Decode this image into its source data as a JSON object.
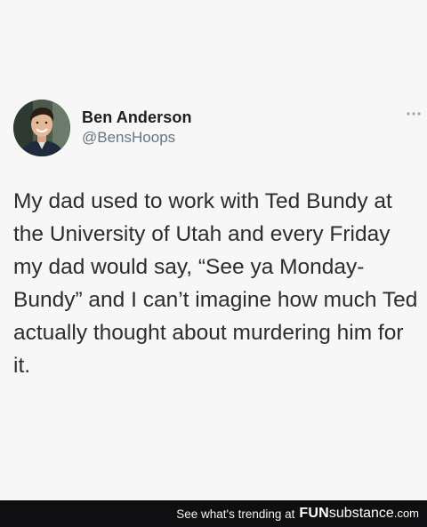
{
  "tweet": {
    "author_name": "Ben Anderson",
    "author_handle": "@BensHoops",
    "text": "My dad used to work with Ted Bundy at the University of Utah and every Friday my dad would say, “See ya Monday-Bundy” and I can’t imagine how much Ted actually thought about murdering him for it."
  },
  "footer": {
    "text": "See what's trending at",
    "brand_fun": "FUN",
    "brand_sub": "substance",
    "brand_tld": ".com"
  },
  "icons": {
    "more": "more-horizontal-icon",
    "avatar": "avatar"
  },
  "colors": {
    "background": "#f7f7f7",
    "handle": "#66757f",
    "footer_bg": "#0f0f12"
  }
}
